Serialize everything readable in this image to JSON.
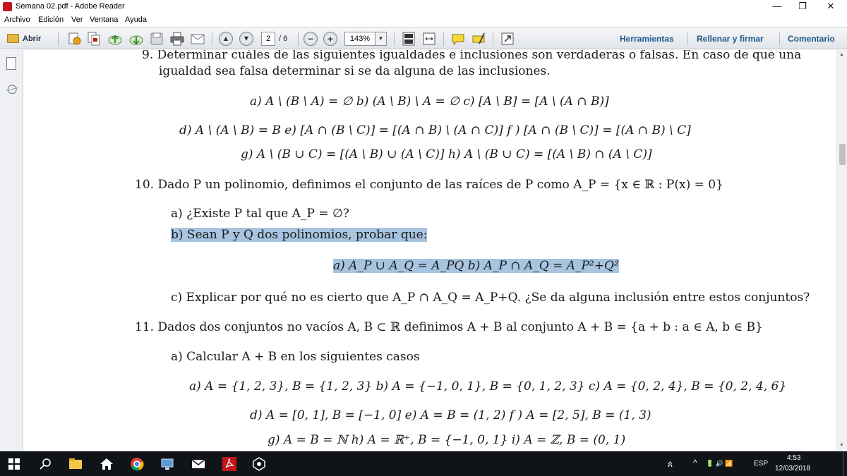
{
  "window": {
    "title": "Semana 02.pdf - Adobe Reader",
    "minimize_glyph": "—",
    "restore_glyph": "❐",
    "close_glyph": "✕"
  },
  "menu": [
    "Archivo",
    "Edición",
    "Ver",
    "Ventana",
    "Ayuda"
  ],
  "toolbar": {
    "open_label": "Abrir",
    "page_current": "2",
    "page_total": "/ 6",
    "zoom": "143%",
    "tools_label": "Herramientas",
    "fill_sign_label": "Rellenar y firmar",
    "comment_label": "Comentario"
  },
  "document": {
    "lines": [
      {
        "id": "q9-l1",
        "text": "9.  Determinar cuáles de las siguientes igualdades e inclusiones son verdaderas o falsas. En caso de que una"
      },
      {
        "id": "q9-l2",
        "text": "igualdad sea falsa determinar si se da alguna de las inclusiones."
      },
      {
        "id": "q9-row1",
        "text": "a)    A \\ (B \\ A) = ∅        b)    (A \\ B) \\ A = ∅        c)    [A \\ B] = [A \\ (A ∩ B)]"
      },
      {
        "id": "q9-row2",
        "text": "d)    A \\ (A \\ B) = B        e)    [A ∩ (B \\ C)] = [(A ∩ B) \\ (A ∩ C)]        f )    [A ∩ (B \\ C)] = [(A ∩ B) \\ C]"
      },
      {
        "id": "q9-row3",
        "text": "g)    A \\ (B ∪ C) = [(A \\ B) ∪ (A \\ C)]        h)    A \\ (B ∪ C) = [(A \\ B) ∩ (A \\ C)]"
      },
      {
        "id": "q10-l1",
        "text": "10.  Dado P un polinomio, definimos el conjunto de las raíces de P como A_P = {x ∈ ℝ : P(x) = 0}"
      },
      {
        "id": "q10-a",
        "text": "a)  ¿Existe P tal que A_P = ∅?"
      },
      {
        "id": "q10-b",
        "text": "b)  Sean P y Q dos polinomios, probar que:"
      },
      {
        "id": "q10-b-items",
        "text": "a)    A_P ∪ A_Q = A_PQ        b)    A_P ∩ A_Q = A_P²+Q²"
      },
      {
        "id": "q10-c",
        "text": "c)  Explicar por qué no es cierto que A_P ∩ A_Q = A_P+Q. ¿Se da alguna inclusión entre estos conjuntos?"
      },
      {
        "id": "q11-l1",
        "text": "11.  Dados dos conjuntos no vacíos A, B ⊂ ℝ definimos A + B al conjunto A + B = {a + b : a ∈ A, b ∈ B}"
      },
      {
        "id": "q11-a",
        "text": "a)  Calcular A + B en los siguientes casos"
      },
      {
        "id": "q11-row1",
        "text": "a)    A = {1, 2, 3},  B = {1, 2, 3}        b)    A = {−1, 0, 1},  B = {0, 1, 2, 3}        c)    A = {0, 2, 4},  B = {0, 2, 4, 6}"
      },
      {
        "id": "q11-row2",
        "text": "d)    A = [0, 1],  B = [−1, 0]        e)    A = B = (1, 2)        f )    A = [2, 5],  B = (1, 3)"
      },
      {
        "id": "q11-row3",
        "text": "g)    A = B = ℕ        h)    A = ℝ⁺,  B = {−1, 0, 1}        i)    A = ℤ,  B = (0, 1)"
      }
    ]
  },
  "taskbar": {
    "lang": "ESP",
    "time": "4:53",
    "date": "12/03/2018",
    "person_glyph": "ጰ",
    "up_glyph": "^",
    "tray_icons": "🔋 🔊 📶"
  }
}
